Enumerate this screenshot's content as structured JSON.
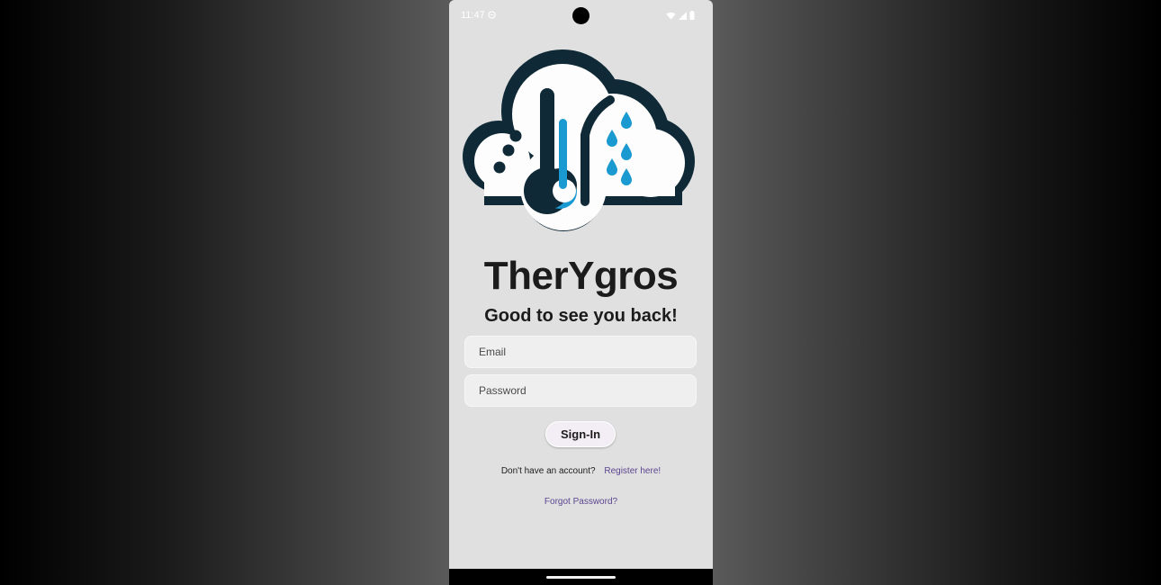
{
  "status_bar": {
    "time": "11:47",
    "icons": [
      "do-not-disturb-icon",
      "wifi-icon",
      "signal-icon",
      "battery-icon"
    ]
  },
  "logo": {
    "icon": "cloud-thermometer-raindrops-logo",
    "colors": {
      "outline": "#0f2a36",
      "accent": "#1b9ad1",
      "fill": "#ffffff"
    }
  },
  "app": {
    "title": "TherYgros",
    "subtitle": "Good to see you back!"
  },
  "form": {
    "email_placeholder": "Email",
    "password_placeholder": "Password",
    "signin_label": "Sign-In"
  },
  "links": {
    "register_question": "Don't have an account?",
    "register_label": "Register here!",
    "forgot_label": "Forgot Password?"
  },
  "theme": {
    "background": "#e0e0e0",
    "link_color": "#5b4690",
    "text_color": "#1b1b1b"
  }
}
